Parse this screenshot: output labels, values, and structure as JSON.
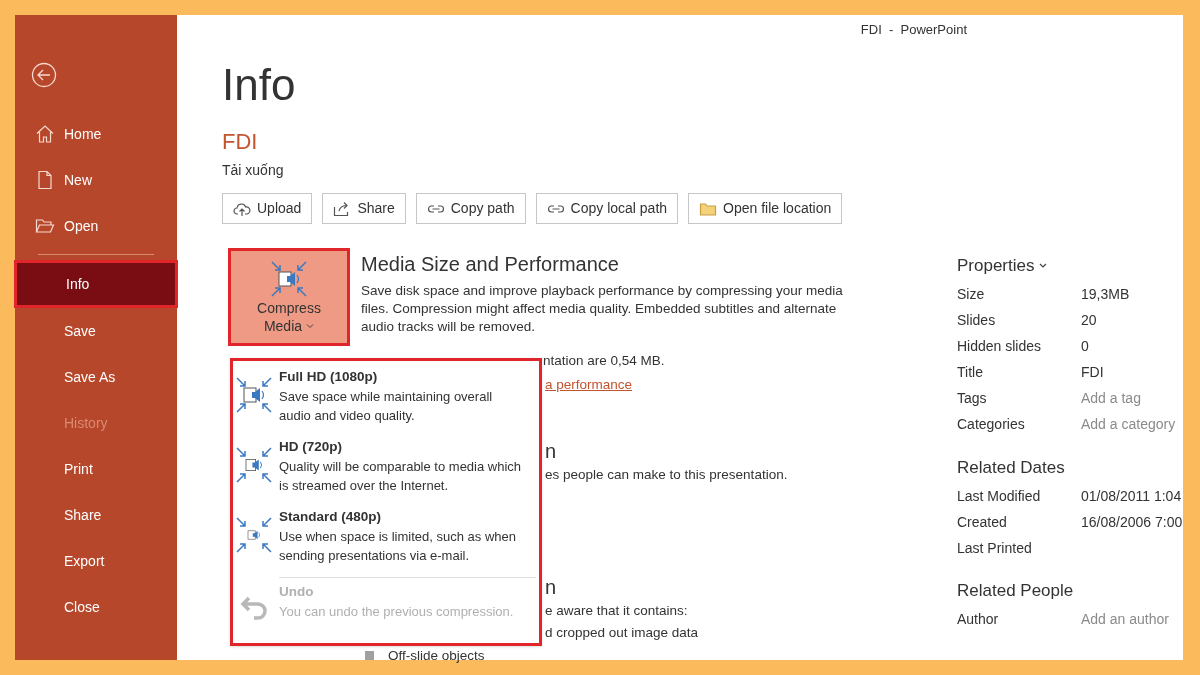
{
  "window": {
    "title": "FDI  -  PowerPoint"
  },
  "sidebar": {
    "items": [
      {
        "label": "Home",
        "kind": "home",
        "selected": false,
        "disabled": false
      },
      {
        "label": "New",
        "kind": "new",
        "selected": false,
        "disabled": false
      },
      {
        "label": "Open",
        "kind": "open",
        "selected": false,
        "disabled": false
      },
      {
        "label": "Info",
        "kind": "plain",
        "selected": true,
        "disabled": false
      },
      {
        "label": "Save",
        "kind": "plain",
        "selected": false,
        "disabled": false
      },
      {
        "label": "Save As",
        "kind": "plain",
        "selected": false,
        "disabled": false
      },
      {
        "label": "History",
        "kind": "plain",
        "selected": false,
        "disabled": true
      },
      {
        "label": "Print",
        "kind": "plain",
        "selected": false,
        "disabled": false
      },
      {
        "label": "Share",
        "kind": "plain",
        "selected": false,
        "disabled": false
      },
      {
        "label": "Export",
        "kind": "plain",
        "selected": false,
        "disabled": false
      },
      {
        "label": "Close",
        "kind": "plain",
        "selected": false,
        "disabled": false
      }
    ]
  },
  "page": {
    "title": "Info",
    "file_name": "FDI",
    "location": "Tải xuống"
  },
  "actions": [
    {
      "label": "Upload",
      "kind": "upload"
    },
    {
      "label": "Share",
      "kind": "share"
    },
    {
      "label": "Copy path",
      "kind": "link"
    },
    {
      "label": "Copy local path",
      "kind": "link"
    },
    {
      "label": "Open file location",
      "kind": "folder"
    }
  ],
  "media": {
    "button": {
      "line1": "Compress",
      "line2": "Media"
    },
    "title": "Media Size and Performance",
    "description": "Save disk space and improve playback performance by compressing your media files. Compression might affect media quality. Embedded subtitles and alternate audio tracks will be removed.",
    "size_note": "ntation are 0,54 MB.",
    "link": "a performance"
  },
  "hidden_sections": [
    {
      "heading": "n",
      "lines": [
        "es people can make to this presentation."
      ]
    },
    {
      "heading": "n",
      "lines": [
        "e aware that it contains:",
        "d cropped out image data"
      ]
    }
  ],
  "bullet": "Off-slide objects",
  "dropdown": [
    {
      "title": "Full HD (1080p)",
      "description": "Save space while maintaining overall audio and video quality.",
      "kind": "large",
      "disabled": false
    },
    {
      "title": "HD (720p)",
      "description": "Quality will be comparable to media which is streamed over the Internet.",
      "kind": "medium",
      "disabled": false
    },
    {
      "title": "Standard (480p)",
      "description": "Use when space is limited, such as when sending presentations via e-mail.",
      "kind": "small",
      "disabled": false
    },
    {
      "title": "Undo",
      "description": "You can undo the previous compression.",
      "kind": "undo",
      "disabled": true
    }
  ],
  "properties": {
    "title": "Properties",
    "rows": [
      {
        "label": "Size",
        "value": "19,3MB"
      },
      {
        "label": "Slides",
        "value": "20"
      },
      {
        "label": "Hidden slides",
        "value": "0"
      },
      {
        "label": "Title",
        "value": "FDI"
      },
      {
        "label": "Tags",
        "placeholder": "Add a tag"
      },
      {
        "label": "Categories",
        "placeholder": "Add a category"
      }
    ]
  },
  "related_dates": {
    "title": "Related Dates",
    "rows": [
      {
        "label": "Last Modified",
        "value": "01/08/2011 1:04"
      },
      {
        "label": "Created",
        "value": "16/08/2006 7:00"
      },
      {
        "label": "Last Printed"
      }
    ]
  },
  "related_people": {
    "title": "Related People",
    "rows": [
      {
        "label": "Author",
        "placeholder": "Add an author"
      }
    ]
  }
}
